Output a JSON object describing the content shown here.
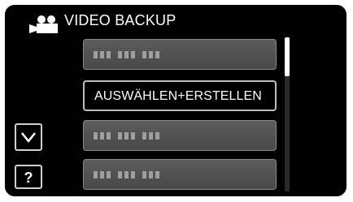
{
  "header": {
    "title": "VIDEO BACKUP",
    "icon": "video-camera-icon"
  },
  "menu": {
    "items": [
      {
        "label": "",
        "masked": true
      },
      {
        "label": "AUSWÄHLEN+ERSTELLEN",
        "selected": true
      },
      {
        "label": "",
        "masked": true
      },
      {
        "label": "",
        "masked": true
      }
    ]
  },
  "side": {
    "down_icon": "chevron-down-icon",
    "help_label": "?"
  },
  "colors": {
    "background": "#000000",
    "button": "#555555",
    "text": "#ffffff"
  }
}
